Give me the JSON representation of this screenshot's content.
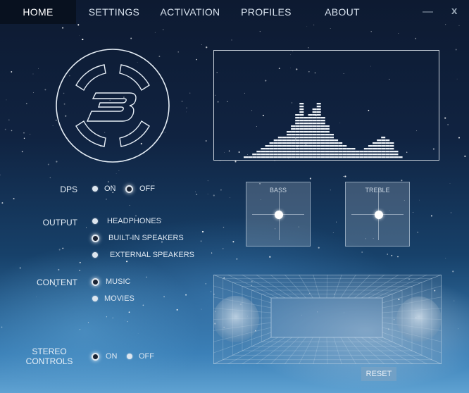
{
  "nav": {
    "tabs": [
      {
        "label": "HOME",
        "active": true
      },
      {
        "label": "SETTINGS",
        "active": false
      },
      {
        "label": "ACTIVATION",
        "active": false
      },
      {
        "label": "PROFILES",
        "active": false
      },
      {
        "label": "ABOUT",
        "active": false
      }
    ],
    "minimize": "—",
    "close": "x"
  },
  "dps": {
    "label": "DPS",
    "on": "ON",
    "off": "OFF",
    "selected": "off"
  },
  "output": {
    "label": "OUTPUT",
    "options": [
      "HEADPHONES",
      "BUILT-IN SPEAKERS",
      "EXTERNAL SPEAKERS"
    ],
    "selected": "BUILT-IN SPEAKERS"
  },
  "content": {
    "label": "CONTENT",
    "options": [
      "MUSIC",
      "MOVIES"
    ],
    "selected": "MUSIC"
  },
  "stereo": {
    "label_line1": "STEREO",
    "label_line2": "CONTROLS",
    "on": "ON",
    "off": "OFF",
    "selected": "on"
  },
  "bass": {
    "label": "BASS"
  },
  "treble": {
    "label": "TREBLE"
  },
  "reset": "RESET",
  "equalizer_levels": [
    1,
    1,
    2,
    3,
    4,
    5,
    6,
    7,
    8,
    8,
    10,
    12,
    16,
    20,
    15,
    16,
    18,
    20,
    15,
    12,
    9,
    7,
    6,
    5,
    4,
    4,
    3,
    3,
    4,
    5,
    6,
    7,
    8,
    7,
    6,
    3,
    1
  ],
  "colors": {
    "accent": "#ffffff",
    "active_tab_bg": "#08111f"
  }
}
